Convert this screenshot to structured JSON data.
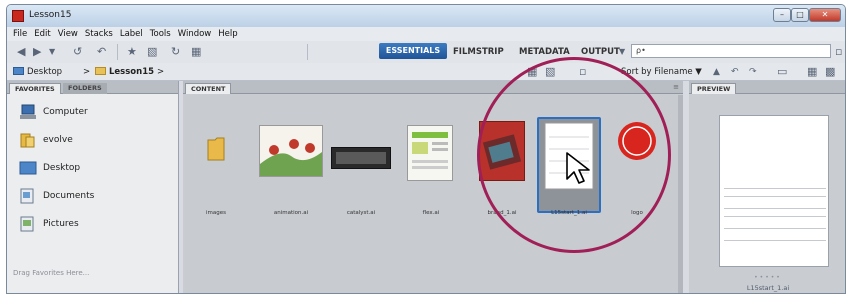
{
  "window": {
    "title": "Lesson15"
  },
  "menu": [
    "File",
    "Edit",
    "View",
    "Stacks",
    "Label",
    "Tools",
    "Window",
    "Help"
  ],
  "workspaces": {
    "active": "ESSENTIALS",
    "others": [
      "FILMSTRIP",
      "METADATA",
      "OUTPUT"
    ]
  },
  "search": {
    "placeholder": "ρ•"
  },
  "path": {
    "items": [
      "Desktop",
      "Lesson15"
    ],
    "separator": ">"
  },
  "sort": {
    "label": "Sort by Filename"
  },
  "left_tabs": [
    "FAVORITES",
    "FOLDERS"
  ],
  "favorites": [
    "Computer",
    "evolve",
    "Desktop",
    "Documents",
    "Pictures"
  ],
  "drag_hint": "Drag Favorites Here...",
  "content_tab": "CONTENT",
  "files": [
    "images",
    "animation.ai",
    "catalyst.ai",
    "flex.ai",
    "brand_1.ai",
    "L15start_1.ai",
    "logo"
  ],
  "selected_file": "L15start_1.ai",
  "preview_tab": "PREVIEW",
  "preview_caption": "L15start_1.ai",
  "colors": {
    "accent": "#1f5497",
    "highlight_circle": "#a01f56",
    "selection": "#2a6fc4"
  }
}
